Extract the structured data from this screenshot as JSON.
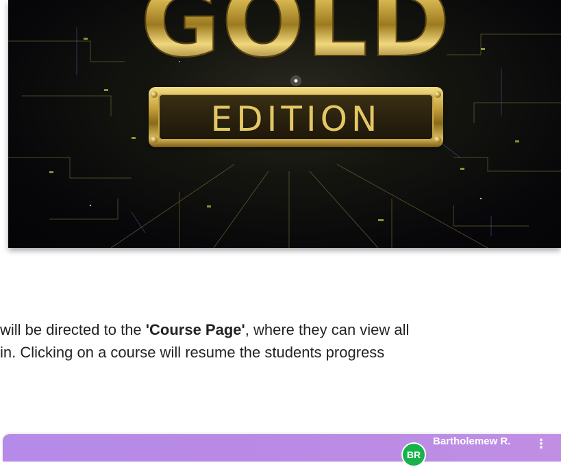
{
  "hero": {
    "title_word": "GOLD",
    "subtitle_word": "EDITION"
  },
  "content": {
    "line1_prefix": "will be directed to the ",
    "line1_bold": "'Course Page'",
    "line1_suffix": ", where they can view all",
    "line2": " in. Clicking on a course will resume the students progress"
  },
  "appbar": {
    "avatar_initials": "BR",
    "user_name": "Bartholemew R.",
    "menu_icon": "kebab-menu-icon",
    "background_color": "#b88ae6",
    "avatar_color": "#17b34a"
  }
}
